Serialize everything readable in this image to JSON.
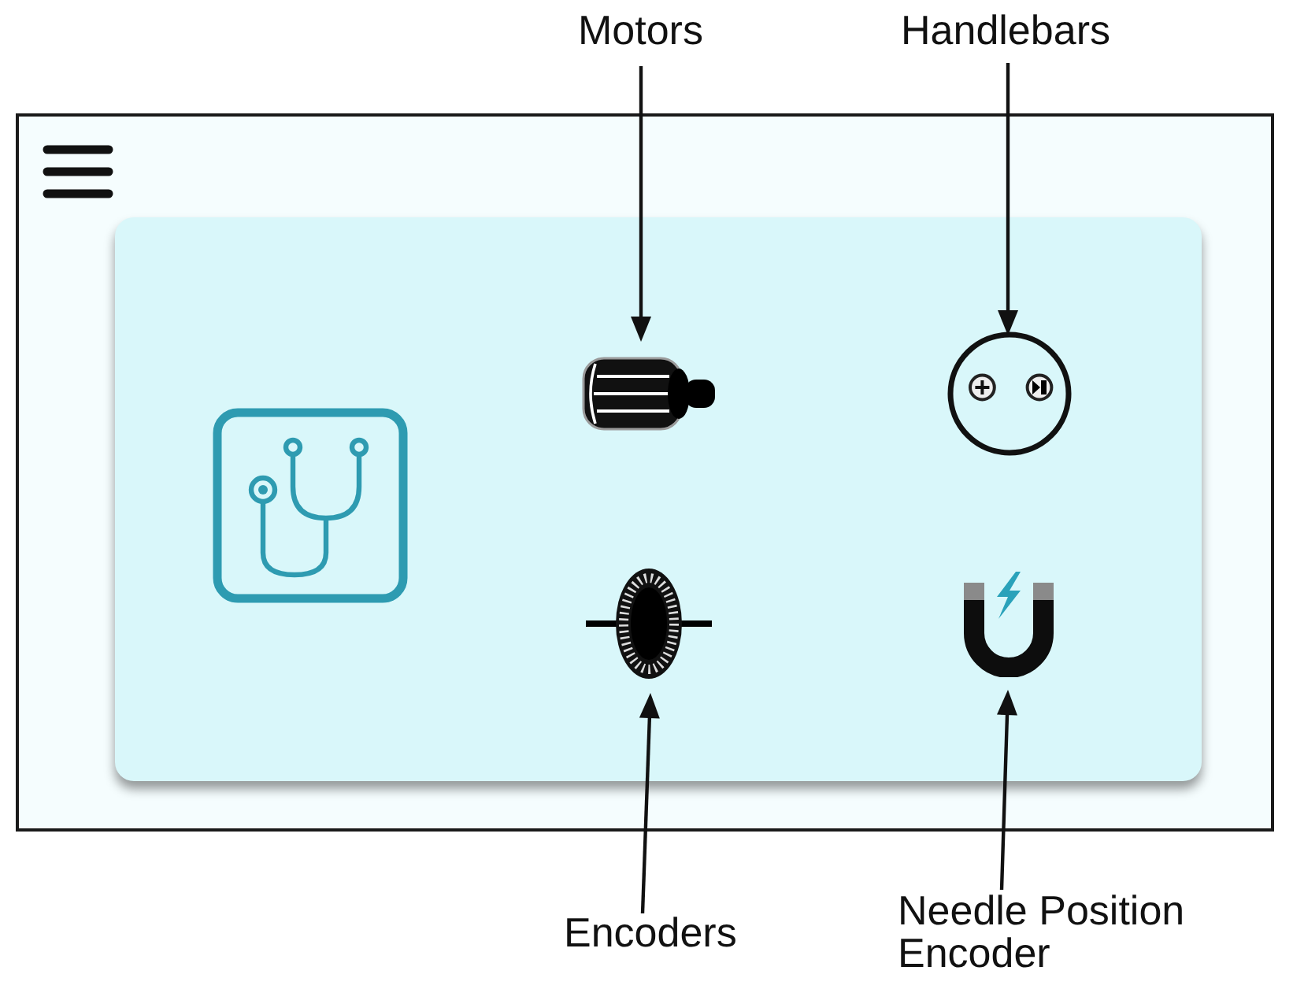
{
  "frame": {
    "card": {
      "components": [
        {
          "kind": "motor",
          "label": "Motors"
        },
        {
          "kind": "handlebar",
          "label": "Handlebars"
        },
        {
          "kind": "encoder",
          "label": "Encoders"
        },
        {
          "kind": "magnet",
          "label": "Needle Position Encoder"
        }
      ]
    }
  }
}
